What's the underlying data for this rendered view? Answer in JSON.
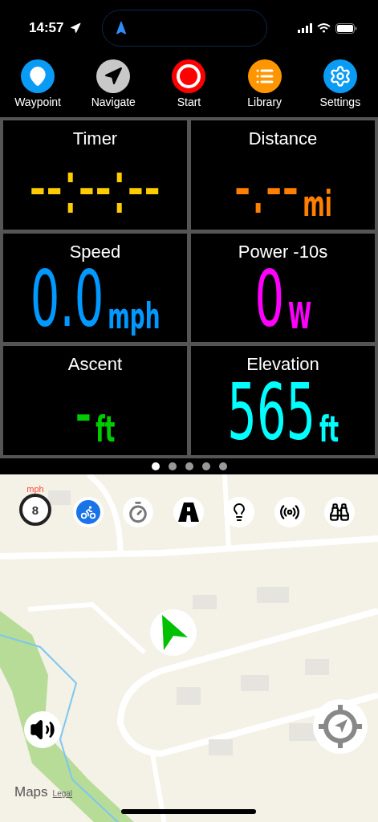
{
  "status_bar": {
    "time": "14:57"
  },
  "toolbar": [
    {
      "label": "Waypoint",
      "kind": "waypoint"
    },
    {
      "label": "Navigate",
      "kind": "navigate"
    },
    {
      "label": "Start",
      "kind": "start"
    },
    {
      "label": "Library",
      "kind": "library"
    },
    {
      "label": "Settings",
      "kind": "settings"
    }
  ],
  "tiles": [
    {
      "title": "Timer",
      "value": "--:--:--",
      "color": "#ffcc00"
    },
    {
      "title": "Distance",
      "value": "-.--",
      "unit": "mi",
      "color": "#ff8000"
    },
    {
      "title": "Speed",
      "value": "0.0",
      "unit": "mph",
      "color": "#0099ff"
    },
    {
      "title": "Power -10s",
      "value": "0",
      "unit": "W",
      "color": "#ff00ff"
    },
    {
      "title": "Ascent",
      "value": "-",
      "unit": "ft",
      "color": "#00cc00"
    },
    {
      "title": "Elevation",
      "value": "565",
      "unit": "ft",
      "color": "#00ffff"
    }
  ],
  "pager": [
    {
      "selected": true
    },
    {
      "selected": false
    },
    {
      "selected": false
    },
    {
      "selected": false
    },
    {
      "selected": false
    }
  ],
  "map": {
    "kind": "picture",
    "speed_limit": {
      "unit": "mph",
      "value": "8"
    },
    "attribution": "Maps",
    "legal": "Legal"
  }
}
